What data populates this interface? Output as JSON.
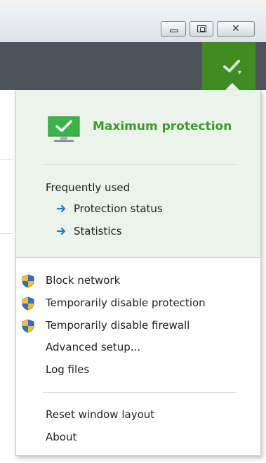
{
  "window": {
    "minimize_icon": "minimize-icon",
    "maximize_icon": "restore-icon",
    "close_glyph": "✕"
  },
  "header": {
    "status_icon": "checkmark-icon",
    "status_color": "#3e8c22"
  },
  "menu": {
    "status": {
      "label": "Maximum protection",
      "color": "#3c9a28",
      "icon": "monitor-check-icon"
    },
    "frequently_used": {
      "heading": "Frequently used",
      "links": [
        {
          "label": "Protection status",
          "icon": "arrow-right-icon"
        },
        {
          "label": "Statistics",
          "icon": "arrow-right-icon"
        }
      ]
    },
    "actions": [
      {
        "label": "Block network",
        "icon": "uac-shield-icon"
      },
      {
        "label": "Temporarily disable protection",
        "icon": "uac-shield-icon"
      },
      {
        "label": "Temporarily disable firewall",
        "icon": "uac-shield-icon"
      },
      {
        "label": "Advanced setup..."
      },
      {
        "label": "Log files"
      }
    ],
    "footer": [
      {
        "label": "Reset window layout"
      },
      {
        "label": "About"
      }
    ]
  }
}
